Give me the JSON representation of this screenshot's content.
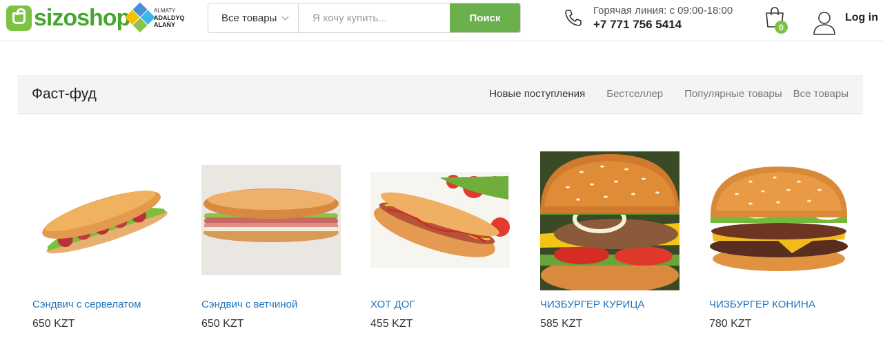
{
  "header": {
    "logo_text": "sizoshop",
    "partner": {
      "line1": "ALMATY",
      "line2": "ADALDYQ",
      "line3": "ALAŃY"
    },
    "search": {
      "category": "Все товары",
      "placeholder": "Я хочу купить...",
      "button": "Поиск"
    },
    "hotline": {
      "label": "Горячая линия: с 09:00-18:00",
      "number": "+7 771 756 5414"
    },
    "cart_count": "0",
    "login": "Log in"
  },
  "category": {
    "title": "Фаст-фуд",
    "tabs": [
      {
        "label": "Новые поступления"
      },
      {
        "label": "Бестселлер"
      },
      {
        "label": "Популярные товары"
      },
      {
        "label": "Все товары"
      }
    ]
  },
  "products": [
    {
      "name": "Сэндвич с сервелатом",
      "price": "650 KZT",
      "image": "salami-sandwich"
    },
    {
      "name": "Сэндвич с ветчиной",
      "price": "650 KZT",
      "image": "ham-sandwich"
    },
    {
      "name": "ХОТ ДОГ",
      "price": "455 KZT",
      "image": "hot-dog"
    },
    {
      "name": "ЧИЗБУРГЕР КУРИЦА",
      "price": "585 KZT",
      "image": "chicken-cheeseburger"
    },
    {
      "name": "ЧИЗБУРГЕР КОНИНА",
      "price": "780 KZT",
      "image": "horse-cheeseburger"
    }
  ],
  "colors": {
    "brand_green": "#6ab04c",
    "link_blue": "#1e73be"
  }
}
